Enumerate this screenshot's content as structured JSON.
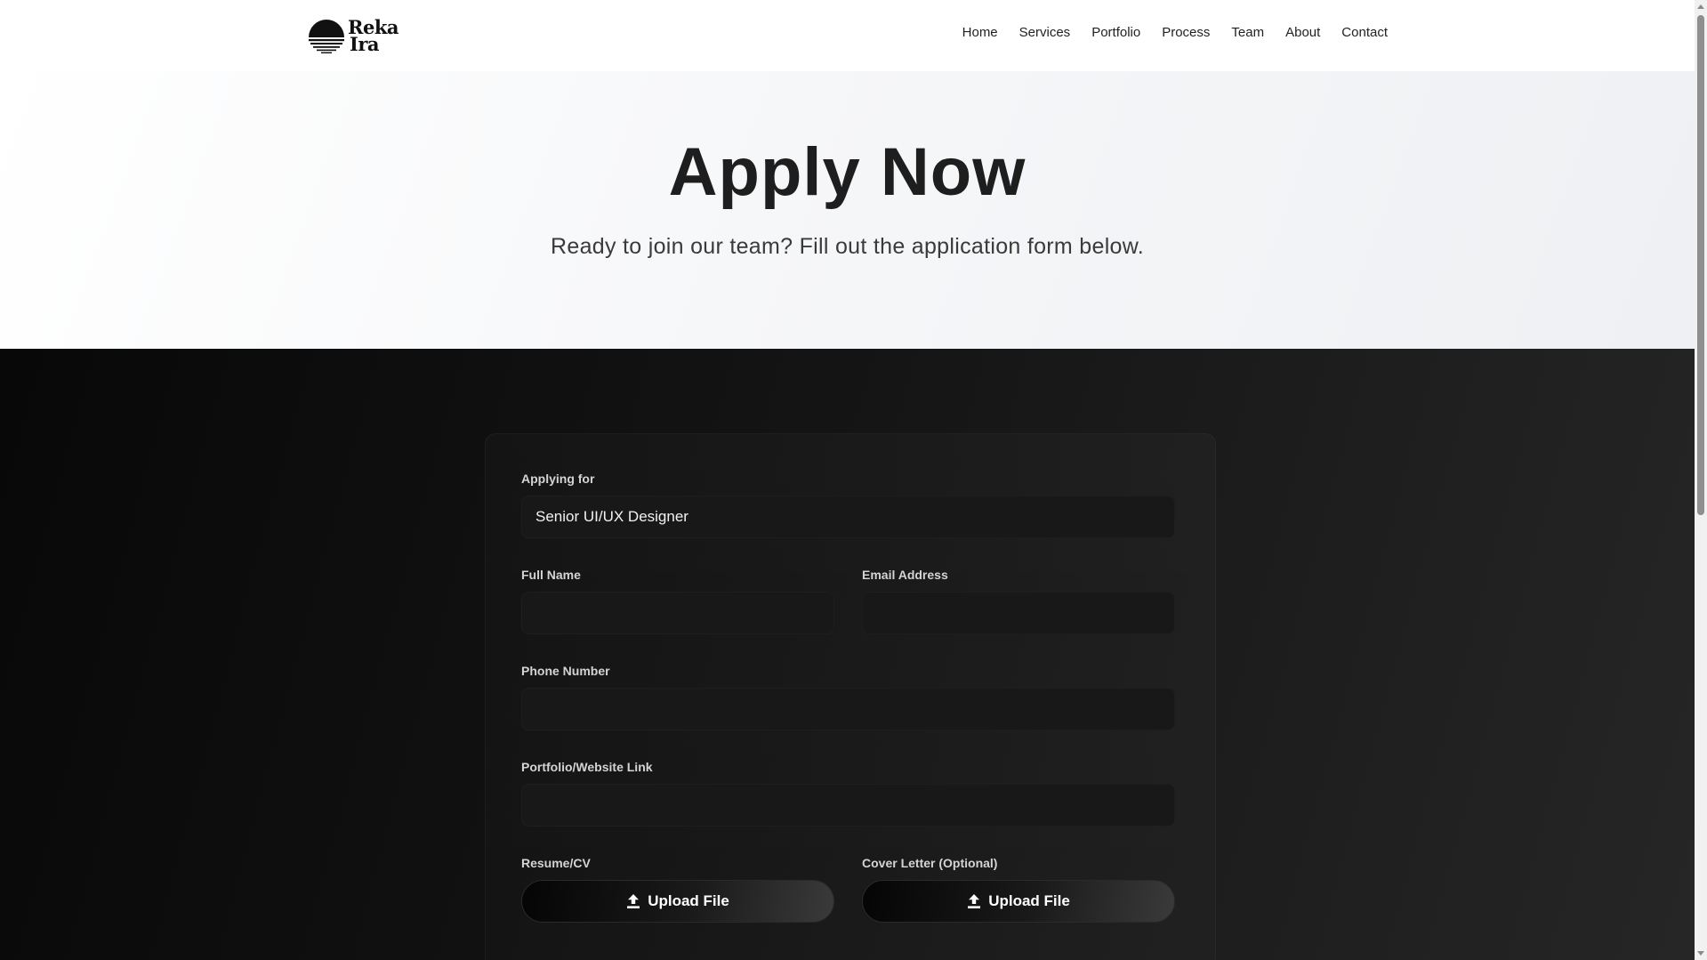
{
  "brand": {
    "line1": "Reka",
    "line2": "Ira"
  },
  "nav": {
    "items": [
      {
        "label": "Home"
      },
      {
        "label": "Services"
      },
      {
        "label": "Portfolio"
      },
      {
        "label": "Process"
      },
      {
        "label": "Team"
      },
      {
        "label": "About"
      },
      {
        "label": "Contact"
      }
    ]
  },
  "hero": {
    "title": "Apply Now",
    "subtitle": "Ready to join our team? Fill out the application form below."
  },
  "form": {
    "applying_for": {
      "label": "Applying for",
      "value": "Senior UI/UX Designer"
    },
    "full_name": {
      "label": "Full Name",
      "value": ""
    },
    "email": {
      "label": "Email Address",
      "value": ""
    },
    "phone": {
      "label": "Phone Number",
      "value": ""
    },
    "portfolio": {
      "label": "Portfolio/Website Link",
      "value": ""
    },
    "resume": {
      "label": "Resume/CV",
      "button": "Upload File"
    },
    "cover_letter": {
      "label": "Cover Letter (Optional)",
      "button": "Upload File"
    }
  },
  "icons": {
    "logo": "sunset-logo-icon",
    "upload": "upload-icon"
  },
  "colors": {
    "hero_bg": "#f6f7f9",
    "dark_bg": "#141414",
    "input_bg": "#181818",
    "text_dark": "#1e1e1e"
  }
}
